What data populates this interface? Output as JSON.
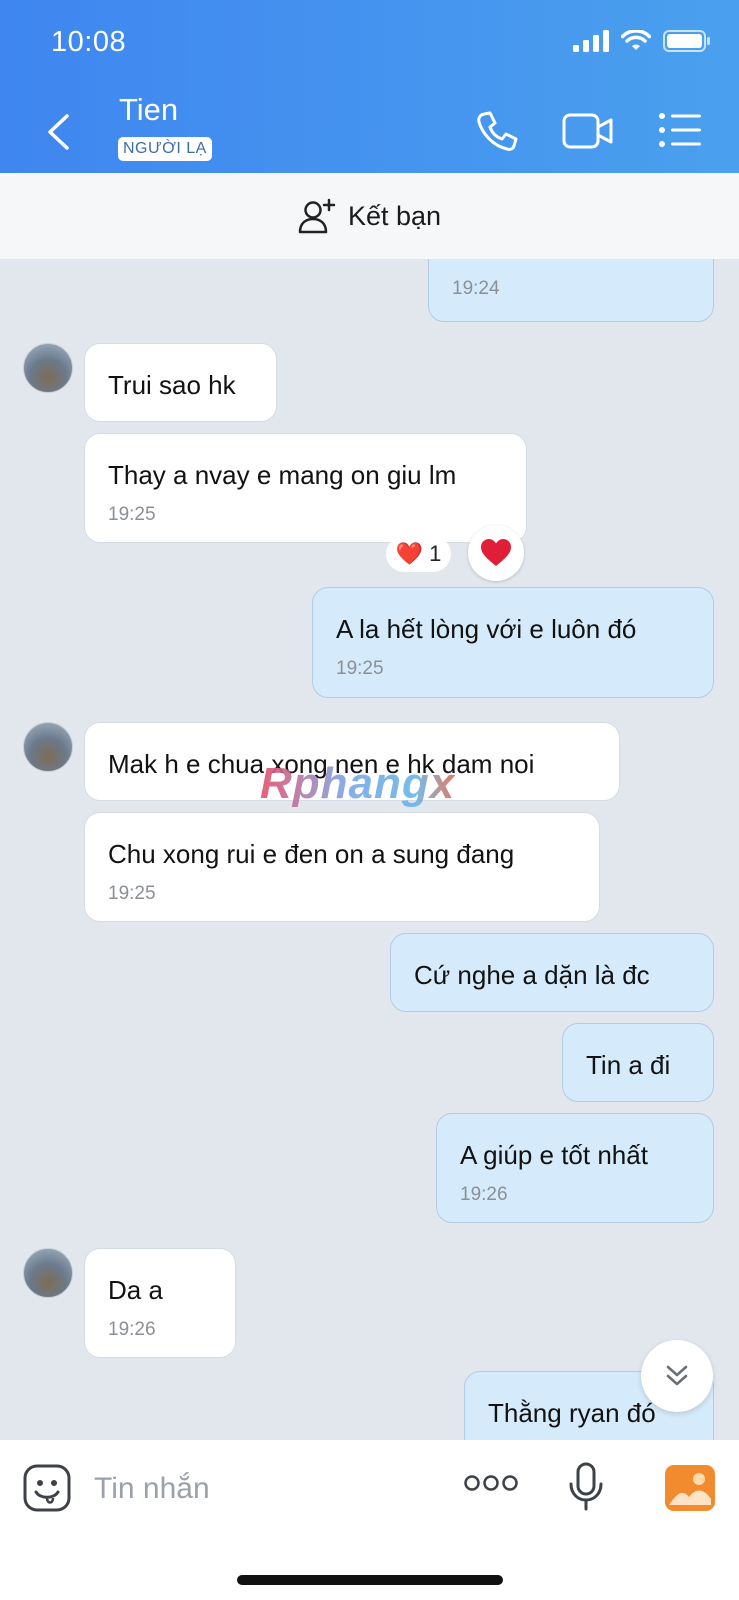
{
  "status_bar": {
    "time": "10:08"
  },
  "header": {
    "contact_name": "Tien",
    "badge": "NGƯỜI LẠ"
  },
  "add_friend": {
    "label": "Kết bạn"
  },
  "messages": [
    {
      "dir": "out",
      "text": "",
      "time": "19:24"
    },
    {
      "dir": "in",
      "text": "Trui sao hk"
    },
    {
      "dir": "in",
      "text": "Thay a nvay e mang on giu lm",
      "time": "19:25",
      "reaction": {
        "emoji": "❤️",
        "count": "1"
      }
    },
    {
      "dir": "out",
      "text": "A la hết lòng với e luôn đó",
      "time": "19:25"
    },
    {
      "dir": "in",
      "text": "Mak h e chua xong nen e hk dam noi"
    },
    {
      "dir": "in",
      "text": "Chu xong rui e đen on a sung đang",
      "time": "19:25"
    },
    {
      "dir": "out",
      "text": "Cứ nghe a dặn là đc"
    },
    {
      "dir": "out",
      "text": "Tin a đi"
    },
    {
      "dir": "out",
      "text": "A giúp e tốt nhất",
      "time": "19:26"
    },
    {
      "dir": "in",
      "text": "Da a",
      "time": "19:26"
    },
    {
      "dir": "out",
      "text": "Thằng ryan đó"
    }
  ],
  "watermark": "Rphangx",
  "composer": {
    "placeholder": "Tin nhắn"
  },
  "colors": {
    "header": "#4a93ee",
    "bubble_out": "#d5ebfb",
    "bubble_in": "#ffffff",
    "chat_bg": "#e2e7ee",
    "reaction": "#e01e37"
  }
}
